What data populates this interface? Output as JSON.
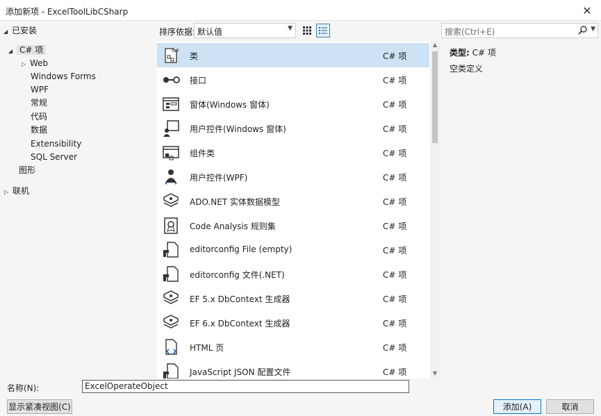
{
  "window": {
    "title": "添加新项 - ExcelToolLibCSharp",
    "close_glyph": "✕"
  },
  "tree": [
    {
      "label": "已安装",
      "expanded": true
    },
    {
      "label": "C# 项",
      "expanded": true
    },
    {
      "label": "Web",
      "expanded": false
    },
    {
      "label": "Windows Forms"
    },
    {
      "label": "WPF"
    },
    {
      "label": "常规"
    },
    {
      "label": "代码"
    },
    {
      "label": "数据"
    },
    {
      "label": "Extensibility"
    },
    {
      "label": "SQL Server"
    },
    {
      "label": "图形"
    },
    {
      "label": "联机",
      "expanded": false
    }
  ],
  "toolbar": {
    "sort_label": "排序依据:",
    "sort_value": "默认值",
    "search_placeholder": "搜索(Ctrl+E)"
  },
  "items": [
    {
      "name": "类",
      "lang": "C# 项",
      "icon": "class-icon"
    },
    {
      "name": "接口",
      "lang": "C# 项",
      "icon": "interface-icon"
    },
    {
      "name": "窗体(Windows 窗体)",
      "lang": "C# 项",
      "icon": "form-icon"
    },
    {
      "name": "用户控件(Windows 窗体)",
      "lang": "C# 项",
      "icon": "user-control-icon"
    },
    {
      "name": "组件类",
      "lang": "C# 项",
      "icon": "component-icon"
    },
    {
      "name": "用户控件(WPF)",
      "lang": "C# 项",
      "icon": "wpf-user-control-icon"
    },
    {
      "name": "ADO.NET 实体数据模型",
      "lang": "C# 项",
      "icon": "data-model-icon"
    },
    {
      "name": "Code Analysis 规则集",
      "lang": "C# 项",
      "icon": "ruleset-icon"
    },
    {
      "name": "editorconfig File (empty)",
      "lang": "C# 项",
      "icon": "editorconfig-icon"
    },
    {
      "name": "editorconfig 文件(.NET)",
      "lang": "C# 项",
      "icon": "editorconfig-icon"
    },
    {
      "name": "EF 5.x DbContext 生成器",
      "lang": "C# 项",
      "icon": "data-model-icon"
    },
    {
      "name": "EF 6.x DbContext 生成器",
      "lang": "C# 项",
      "icon": "data-model-icon"
    },
    {
      "name": "HTML 页",
      "lang": "C# 项",
      "icon": "html-icon"
    },
    {
      "name": "JavaScript JSON 配置文件",
      "lang": "C# 项",
      "icon": "json-icon"
    }
  ],
  "details": {
    "type_label": "类型:",
    "type_value": "C# 项",
    "description": "空类定义"
  },
  "bottom": {
    "name_label": "名称(N):",
    "name_value": "ExcelOperateObject",
    "compact_view_label": "显示紧凑视图(C)",
    "add_label": "添加(A)",
    "cancel_label": "取消"
  },
  "colors": {
    "selection": "#cde2f4",
    "accent": "#0078d7"
  }
}
